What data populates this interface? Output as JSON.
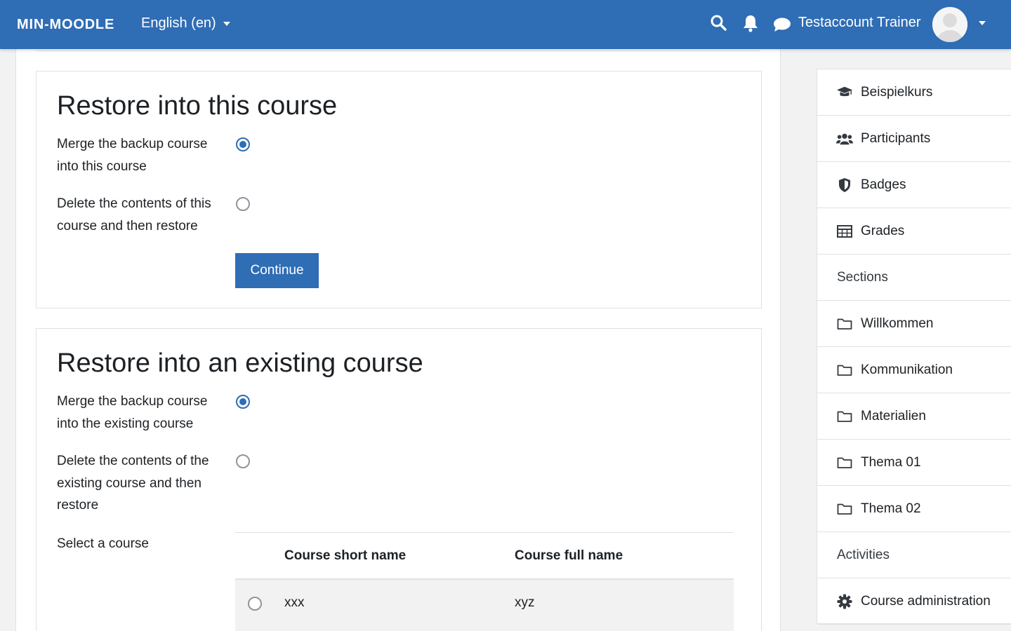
{
  "navbar": {
    "brand": "MIN-MOODLE",
    "language": "English (en)",
    "username": "Testaccount Trainer"
  },
  "restore_this": {
    "title": "Restore into this course",
    "options": [
      {
        "label": "Merge the backup course into this course",
        "checked": true
      },
      {
        "label": "Delete the contents of this course and then restore",
        "checked": false
      }
    ],
    "continue_label": "Continue"
  },
  "restore_existing": {
    "title": "Restore into an existing course",
    "options": [
      {
        "label": "Merge the backup course into the existing course",
        "checked": true
      },
      {
        "label": "Delete the contents of the existing course and then restore",
        "checked": false
      }
    ],
    "select_label": "Select a course",
    "table": {
      "headers": [
        "Course short name",
        "Course full name"
      ],
      "rows": [
        {
          "short": "xxx",
          "full": "xyz",
          "checked": false
        }
      ]
    }
  },
  "sidebar": {
    "items": [
      {
        "label": "Beispielkurs",
        "icon": "graduation-cap-icon"
      },
      {
        "label": "Participants",
        "icon": "users-icon"
      },
      {
        "label": "Badges",
        "icon": "shield-icon"
      },
      {
        "label": "Grades",
        "icon": "table-icon"
      },
      {
        "label": "Sections",
        "icon": ""
      },
      {
        "label": "Willkommen",
        "icon": "folder-icon"
      },
      {
        "label": "Kommunikation",
        "icon": "folder-icon"
      },
      {
        "label": "Materialien",
        "icon": "folder-icon"
      },
      {
        "label": "Thema 01",
        "icon": "folder-icon"
      },
      {
        "label": "Thema 02",
        "icon": "folder-icon"
      },
      {
        "label": "Activities",
        "icon": ""
      },
      {
        "label": "Course administration",
        "icon": "gear-icon"
      }
    ]
  },
  "colors": {
    "brand": "#2f6db5",
    "border": "#dee2e6",
    "row_bg": "#f2f2f2"
  }
}
